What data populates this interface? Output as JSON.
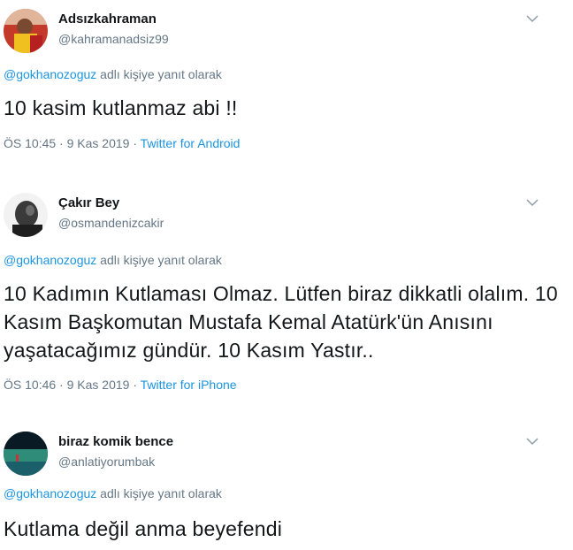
{
  "tweets": [
    {
      "name": "Adsızkahraman",
      "handle": "@kahramanadsiz99",
      "reply_mention": "@gokhanozoguz",
      "reply_text": " adlı kişiye yanıt olarak",
      "text": "10 kasim kutlanmaz abi !!",
      "time": "ÖS 10:45 · 9 Kas 2019 · ",
      "source": "Twitter for Android"
    },
    {
      "name": "Çakır Bey",
      "handle": "@osmandenizcakir",
      "reply_mention": "@gokhanozoguz",
      "reply_text": " adlı kişiye yanıt olarak",
      "text": "10 Kadımın Kutlaması Olmaz. Lütfen biraz dikkatli olalım. 10 Kasım Başkomutan Mustafa Kemal Atatürk'ün Anısını yaşatacağımız gündür. 10 Kasım Yastır..",
      "time": "ÖS 10:46 · 9 Kas 2019 · ",
      "source": "Twitter for iPhone"
    },
    {
      "name": "biraz komik bence",
      "handle": "@anlatiyorumbak",
      "reply_mention": "@gokhanozoguz",
      "reply_text": " adlı kişiye yanıt olarak",
      "text": "Kutlama değil anma beyefendi"
    }
  ],
  "icons": {
    "more": "chevron-down-icon"
  },
  "colors": {
    "link": "#1b95e0",
    "muted": "#657786",
    "text": "#14171a"
  }
}
